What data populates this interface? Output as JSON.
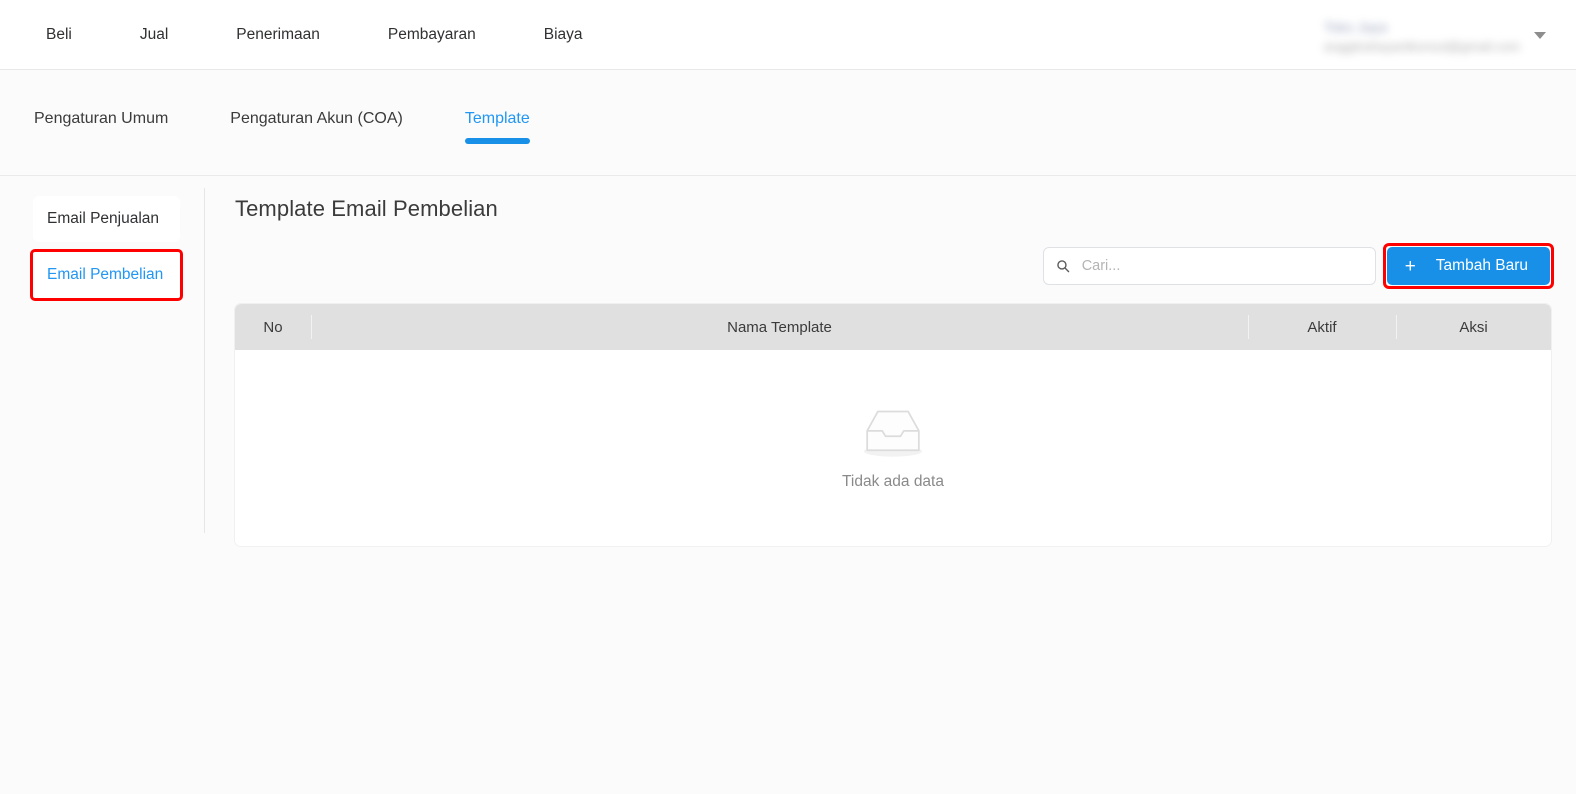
{
  "topnav": {
    "items": [
      {
        "label": "Beli"
      },
      {
        "label": "Jual"
      },
      {
        "label": "Penerimaan"
      },
      {
        "label": "Pembayaran"
      },
      {
        "label": "Biaya"
      }
    ],
    "user": {
      "name": "Toko Jaya",
      "email": "anggitrahayantkonsul@gmail.com",
      "caret_icon": "chevron-down-icon"
    }
  },
  "subtabs": {
    "items": [
      {
        "label": "Pengaturan Umum",
        "active": false
      },
      {
        "label": "Pengaturan Akun (COA)",
        "active": false
      },
      {
        "label": "Template",
        "active": true
      }
    ],
    "active_color": "#1890e8"
  },
  "sidebar": {
    "items": [
      {
        "label": "Email Penjualan",
        "active": false,
        "highlighted": false
      },
      {
        "label": "Email Pembelian",
        "active": true,
        "highlighted": true
      }
    ]
  },
  "main": {
    "title": "Template Email Pembelian",
    "search": {
      "placeholder": "Cari...",
      "value": "",
      "icon": "search-icon"
    },
    "add_button": {
      "label": "Tambah Baru",
      "icon": "plus-icon",
      "color": "#1890e8",
      "highlighted": true
    },
    "table": {
      "columns": [
        "No",
        "Nama Template",
        "Aktif",
        "Aksi"
      ],
      "rows": [],
      "empty_state": {
        "icon": "empty-inbox-icon",
        "text": "Tidak ada data"
      }
    }
  },
  "annotation": {
    "color": "#ff0000",
    "targets": [
      "sidebar-item-email-pembelian",
      "add-new-button"
    ]
  }
}
